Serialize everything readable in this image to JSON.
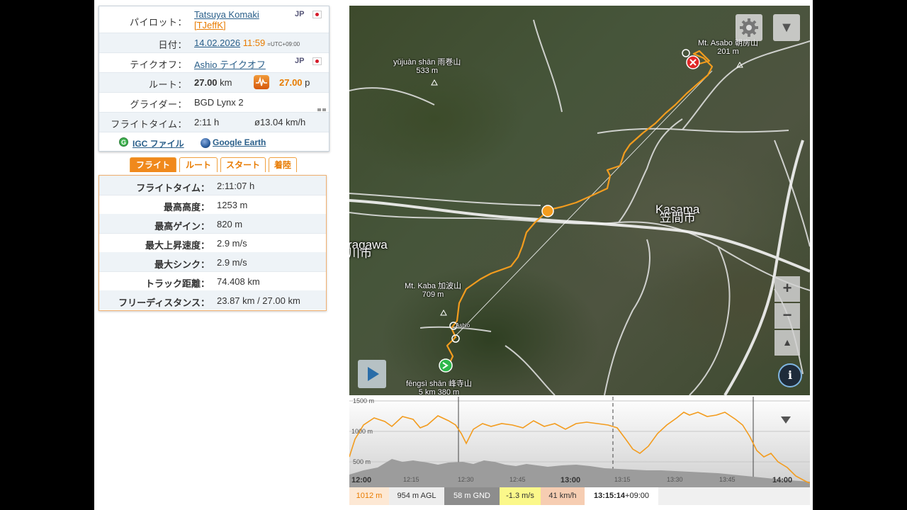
{
  "info": {
    "pilot": {
      "label": "パイロット：",
      "name": "Tatsuya Komaki",
      "handle": "[TJeffK]",
      "country": "JP"
    },
    "date": {
      "label": "日付：",
      "value": "14.02.2026",
      "time": "11:59",
      "tz": "=UTC+09:00"
    },
    "takeoff": {
      "label": "テイクオフ：",
      "value": "Ashio テイクオフ",
      "country": "JP"
    },
    "route": {
      "label": "ルート：",
      "distance": "27.00",
      "unit": "km",
      "points": "27.00",
      "points_unit": "p"
    },
    "glider": {
      "label": "グライダー：",
      "value": "BGD Lynx 2"
    },
    "flight_time": {
      "label": "フライトタイム：",
      "value": "2:11 h",
      "avg_speed": "ø13.04 km/h"
    },
    "files": {
      "igc": "IGC ファイル",
      "g": "G",
      "google_earth": "Google Earth"
    }
  },
  "tabs": [
    "フライト",
    "ルート",
    "スタート",
    "着陸"
  ],
  "stats": [
    {
      "label": "フライトタイム：",
      "value": "2:11:07 h"
    },
    {
      "label": "最高高度：",
      "value": "1253 m"
    },
    {
      "label": "最高ゲイン：",
      "value": "820 m"
    },
    {
      "label": "最大上昇速度：",
      "value": "2.9 m/s"
    },
    {
      "label": "最大シンク：",
      "value": "2.9 m/s"
    },
    {
      "label": "トラック距離：",
      "value": "74.408 km"
    },
    {
      "label": "フリーディスタンス：",
      "value": "23.87 km / 27.00 km"
    }
  ],
  "map": {
    "labels": {
      "asabo": "Mt. Asabo 朝房山",
      "asabo_elev": "201 m",
      "yujuan": "yǔjuàn shān 雨巻山",
      "yujuan_elev": "533 m",
      "kasama_en": "Kasama",
      "kasama_jp": "笠間市",
      "ragawa": "ragawa",
      "ragawa_jp": "川市",
      "kaba": "Mt. Kaba 加波山",
      "kaba_elev": "709 m",
      "fengsi": "fēngsì shān 峰寺山",
      "fengsi_km": "5 km",
      "fengsi_elev": "380 m",
      "start_marker": "Ashio"
    },
    "controls": {
      "zoom_in": "+",
      "zoom_out": "−",
      "reset": "▲",
      "settings": "gear-icon",
      "dropdown": "▼",
      "info": "i",
      "play": "play-icon"
    },
    "track_color": "#f39c1e"
  },
  "profile": {
    "y_labels": [
      "1500 m",
      "1000 m",
      "500 m"
    ],
    "x_labels": [
      "12:00",
      "12:15",
      "12:30",
      "12:45",
      "13:00",
      "13:15",
      "13:30",
      "13:45",
      "14:00"
    ],
    "altitude_color": "#f39c1e",
    "ground_color": "#9c9c9c"
  },
  "status": {
    "altitude": "1012 m",
    "agl": "954 m AGL",
    "gnd": "58 m GND",
    "vario": "-1.3 m/s",
    "speed": "41 km/h",
    "time": "13:15:14",
    "tz": "+09:00"
  }
}
